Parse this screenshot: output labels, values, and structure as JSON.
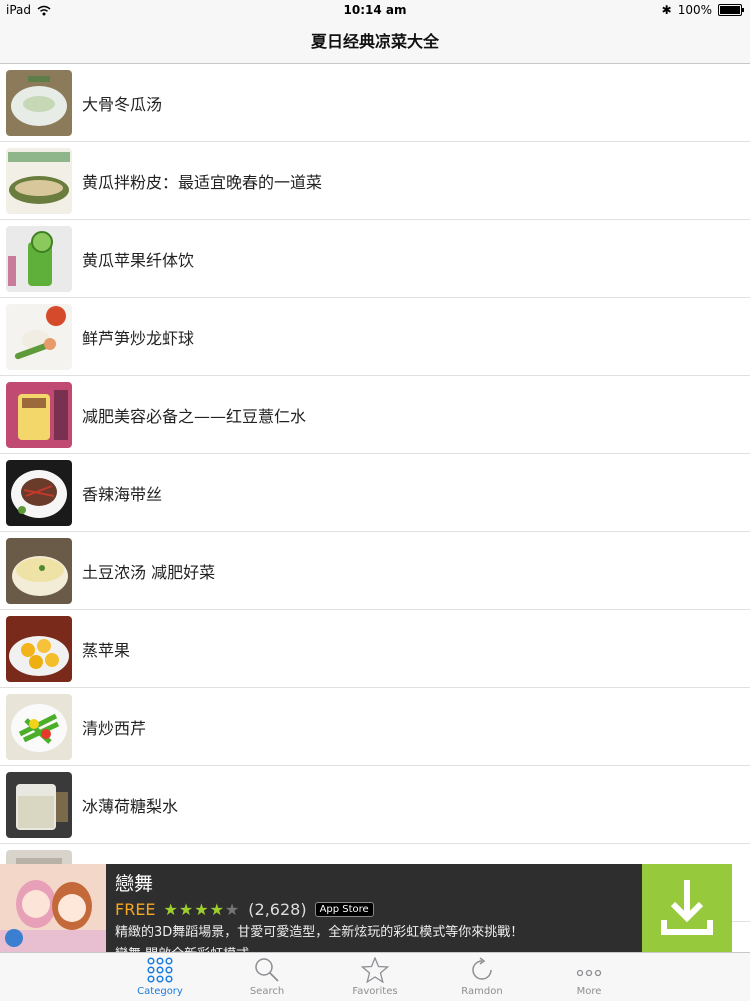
{
  "status_bar": {
    "device": "iPad",
    "time": "10:14 am",
    "battery": "100%"
  },
  "nav": {
    "title": "夏日经典凉菜大全"
  },
  "recipes": [
    {
      "title": "大骨冬瓜汤"
    },
    {
      "title": "黄瓜拌粉皮：最适宜晚春的一道菜"
    },
    {
      "title": "黄瓜苹果纤体饮"
    },
    {
      "title": "鲜芦笋炒龙虾球"
    },
    {
      "title": "减肥美容必备之——红豆薏仁水"
    },
    {
      "title": "香辣海带丝"
    },
    {
      "title": "土豆浓汤 减肥好菜"
    },
    {
      "title": "蒸苹果"
    },
    {
      "title": "清炒西芹"
    },
    {
      "title": "冰薄荷糖梨水"
    }
  ],
  "ad": {
    "name": "戀舞",
    "price": "FREE",
    "rating_stars": 4,
    "rating_count": "(2,628)",
    "store_badge": "App Store",
    "desc_line1": "精緻的3D舞蹈場景，甘愛可愛造型，全新炫玩的彩虹模式等你來挑戰！",
    "desc_line2": "戀舞 開啟全新彩虹模式"
  },
  "tabs": [
    {
      "label": "Category",
      "icon": "grid-icon",
      "active": true
    },
    {
      "label": "Search",
      "icon": "search-icon",
      "active": false
    },
    {
      "label": "Favorites",
      "icon": "star-icon",
      "active": false
    },
    {
      "label": "Ramdon",
      "icon": "refresh-icon",
      "active": false
    },
    {
      "label": "More",
      "icon": "more-icon",
      "active": false
    }
  ],
  "colors": {
    "active_tab": "#1a7be0",
    "inactive_tab": "#8e8e93",
    "ad_accent": "#97c93c"
  }
}
